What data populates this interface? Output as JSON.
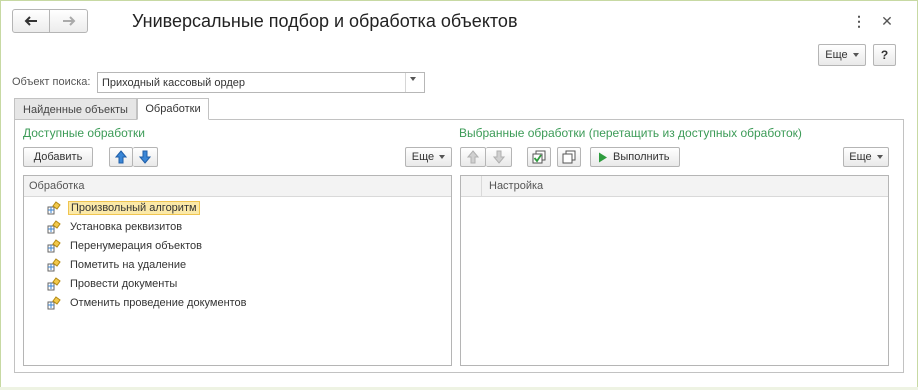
{
  "window": {
    "title": "Универсальные подбор и обработка объектов",
    "menu_icon": "more-vertical-icon",
    "close_icon": "close-icon"
  },
  "nav": {
    "back_icon": "arrow-left-icon",
    "forward_icon": "arrow-right-icon"
  },
  "header_toolbar": {
    "more_label": "Еще",
    "help_label": "?"
  },
  "search": {
    "label": "Объект поиска:",
    "value": "Приходный кассовый ордер"
  },
  "tabs": [
    {
      "label": "Найденные объекты",
      "active": false
    },
    {
      "label": "Обработки",
      "active": true
    }
  ],
  "available": {
    "title": "Доступные обработки",
    "add_label": "Добавить",
    "more_label": "Еще",
    "column_header": "Обработка",
    "items": [
      {
        "label": "Произвольный алгоритм",
        "selected": true
      },
      {
        "label": "Установка реквизитов",
        "selected": false
      },
      {
        "label": "Перенумерация объектов",
        "selected": false
      },
      {
        "label": "Пометить на удаление",
        "selected": false
      },
      {
        "label": "Провести документы",
        "selected": false
      },
      {
        "label": "Отменить проведение документов",
        "selected": false
      }
    ]
  },
  "selected": {
    "title": "Выбранные обработки (перетащить из доступных обработок)",
    "execute_label": "Выполнить",
    "more_label": "Еще",
    "column_header": "Настройка"
  },
  "colors": {
    "accent_green": "#3c9b57",
    "selection": "#fbe9a8",
    "frame": "#c7d9a3"
  }
}
